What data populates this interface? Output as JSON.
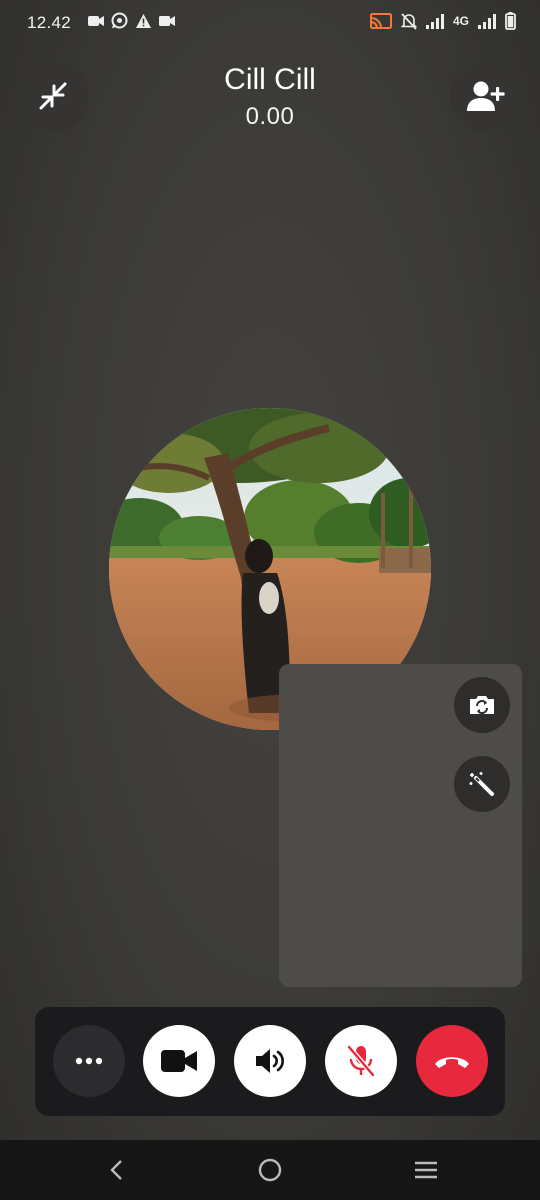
{
  "status_bar": {
    "time": "12.42",
    "left_icons": [
      "video-camera-icon",
      "whatsapp-icon",
      "warning-icon",
      "video-record-icon"
    ],
    "network": "4G",
    "right_icons": [
      "cast-icon",
      "notifications-off-icon",
      "signal-icon",
      "4g-signal-icon",
      "battery-icon"
    ]
  },
  "call": {
    "name": "Cill Cill",
    "timer": "0.00"
  },
  "top_actions": {
    "minimize_icon": "minimize-arrows-icon",
    "add_person_icon": "add-person-icon"
  },
  "side_actions": [
    "flip-camera-icon",
    "effects-wand-icon"
  ],
  "controls": [
    {
      "name": "more-options",
      "icon": "more-icon"
    },
    {
      "name": "video",
      "icon": "video-camera-icon"
    },
    {
      "name": "speaker",
      "icon": "speaker-icon"
    },
    {
      "name": "mute",
      "icon": "mic-off-icon",
      "state": "muted"
    },
    {
      "name": "end-call",
      "icon": "phone-hangup-icon"
    }
  ],
  "colors": {
    "end_call": "#e8283c",
    "mic_off": "#e8283c",
    "control_bar": "#1b1b1d",
    "background": "#3b3a37"
  },
  "nav_bar": [
    "back-icon",
    "home-icon",
    "recents-icon"
  ]
}
